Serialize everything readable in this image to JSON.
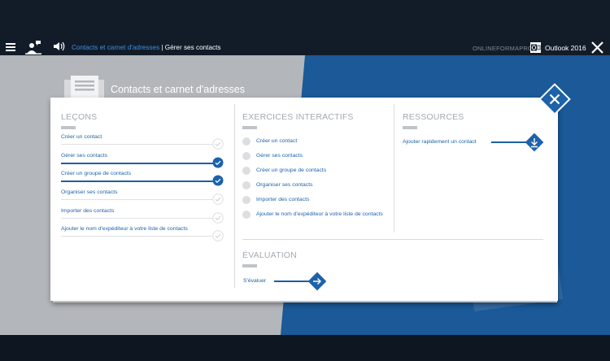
{
  "topbar": {
    "breadcrumb_link": "Contacts et carnet d'adresses",
    "breadcrumb_sep": " | ",
    "breadcrumb_current": "Gérer ses contacts",
    "brand": "ONLINEFORMAPRO",
    "product": "Outlook 2016"
  },
  "module": {
    "title": "Contacts et carnet d'adresses"
  },
  "lessons": {
    "title": "LEÇONS",
    "items": [
      {
        "label": "Créer un contact",
        "completed": false
      },
      {
        "label": "Gérer ses contacts",
        "completed": true
      },
      {
        "label": "Créer un groupe de contacts",
        "completed": true
      },
      {
        "label": "Organiser ses contacts",
        "completed": false
      },
      {
        "label": "Importer des contacts",
        "completed": false
      },
      {
        "label": "Ajouter le nom d'expéditeur à votre liste de contacts",
        "completed": false
      }
    ]
  },
  "exercises": {
    "title": "EXERCICES INTERACTIFS",
    "items": [
      {
        "label": "Créer un contact"
      },
      {
        "label": "Gérer ses contacts"
      },
      {
        "label": "Créer un groupe de contacts"
      },
      {
        "label": "Organiser ses contacts"
      },
      {
        "label": "Importer des contacts"
      },
      {
        "label": "Ajouter le nom d'expéditeur à votre liste de contacts"
      }
    ]
  },
  "resources": {
    "title": "RESSOURCES",
    "items": [
      {
        "label": "Ajouter rapidement un contact"
      }
    ]
  },
  "evaluation": {
    "title": "ÉVALUATION",
    "link": "S'évaluer"
  },
  "icons": {
    "menu": "hamburger-menu-icon",
    "user": "user-chat-icon",
    "sound": "speaker-icon",
    "outlook": "outlook-icon",
    "close": "close-icon",
    "check": "check-circle-icon",
    "download": "download-icon",
    "arrow": "arrow-right-icon",
    "document": "document-stack-icon"
  },
  "colors": {
    "accent": "#1d62ab",
    "stage_blue": "#1b5998",
    "topbar": "#121c29",
    "stage_grey": "#b3b6ba"
  }
}
